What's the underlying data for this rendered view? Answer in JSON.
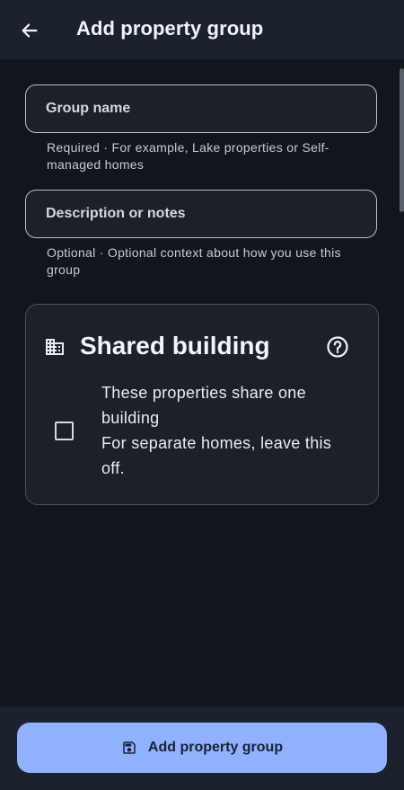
{
  "appbar": {
    "title": "Add property group",
    "back_icon": "arrow-left-icon"
  },
  "form": {
    "group_name": {
      "placeholder": "Group name",
      "value": "",
      "helper": "Required · For example, Lake properties or Self-managed homes"
    },
    "description": {
      "placeholder": "Description or notes",
      "value": "",
      "helper": "Optional · Optional context about how you use this group"
    }
  },
  "shared_building": {
    "icon": "building-icon",
    "title": "Shared building",
    "help_icon": "help-circle-icon",
    "checked": false,
    "line1": "These properties share one building",
    "line2": "For separate homes, leave this off."
  },
  "footer": {
    "button_label": "Add property group",
    "button_icon": "save-icon"
  },
  "colors": {
    "background": "#11151c",
    "appbar": "#1c222c",
    "field_bg": "#1b2029",
    "primary_button": "#8fb1ff",
    "primary_button_text": "#1a2234"
  }
}
